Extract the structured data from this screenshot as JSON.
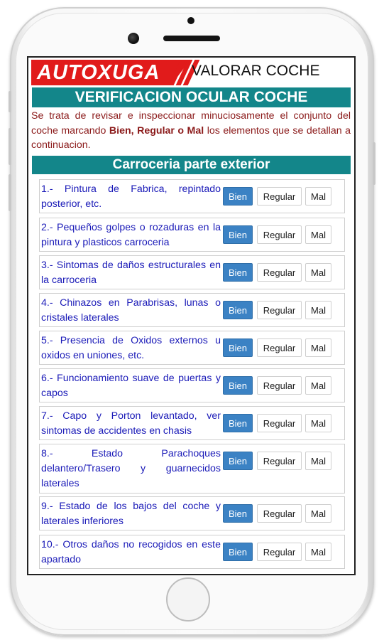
{
  "header": {
    "logo_text": "AUTOXUGA",
    "app_title": "VALORAR COCHE"
  },
  "section_title": "VERIFICACION OCULAR COCHE",
  "intro": {
    "part1": "Se trata de revisar e inspeccionar minuciosamente el conjunto del coche marcando ",
    "bold": "Bien, Regular o Mal",
    "part2": " los elementos que se detallan a continuacion."
  },
  "subsection_title": "Carroceria parte exterior",
  "buttons": {
    "good": "Bien",
    "regular": "Regular",
    "bad": "Mal"
  },
  "items": [
    "1.- Pintura de Fabrica, repintado posterior, etc.",
    "2.- Pequeños golpes o rozaduras en la pintura y plasticos carroceria",
    "3.- Sintomas de daños estructurales en la carroceria",
    "4.- Chinazos en Parabrisas, lunas o cristales laterales",
    "5.- Presencia de Oxidos externos u oxidos en uniones, etc.",
    "6.- Funcionamiento suave de puertas y capos",
    "7.- Capo y Porton levantado, ver sintomas de accidentes en chasis",
    "8.- Estado Parachoques delantero/Trasero y guarnecidos laterales",
    "9.- Estado de los bajos del coche y laterales inferiores",
    "10.- Otros daños no recogidos en este apartado"
  ],
  "colors": {
    "brand_red": "#e11b1b",
    "section_teal": "#13868a",
    "item_text_blue": "#1b1bb8",
    "intro_text_dark_red": "#8b1a1a",
    "good_button_blue": "#3b82c4"
  }
}
